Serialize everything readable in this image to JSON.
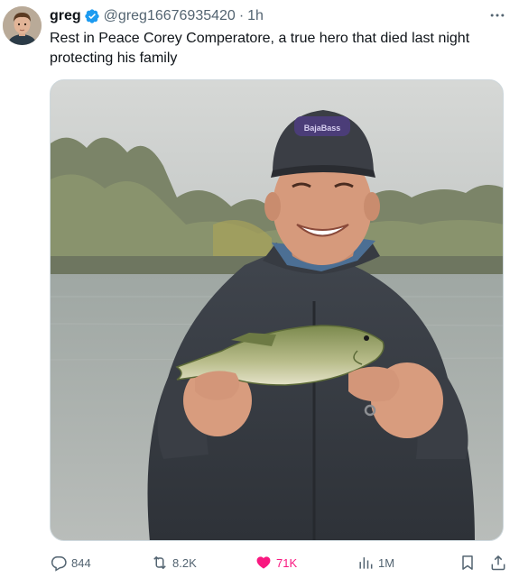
{
  "author": {
    "display_name": "greg",
    "handle": "@greg16676935420",
    "separator": "·",
    "time": "1h",
    "verified": true
  },
  "tweet": {
    "text": "Rest in Peace Corey Comperatore, a true hero that died last night protecting his family"
  },
  "media": {
    "cap_text": "BajaBass"
  },
  "actions": {
    "replies": "844",
    "reposts": "8.2K",
    "likes": "71K",
    "views": "1M"
  },
  "icons": {
    "verified": "verified-badge-icon",
    "more": "more-icon",
    "reply": "reply-icon",
    "repost": "repost-icon",
    "like": "heart-icon",
    "views": "views-icon",
    "bookmark": "bookmark-icon",
    "share": "share-icon"
  },
  "colors": {
    "accent_blue": "#1d9bf0",
    "like_pink": "#f91880",
    "secondary_text": "#536471"
  }
}
